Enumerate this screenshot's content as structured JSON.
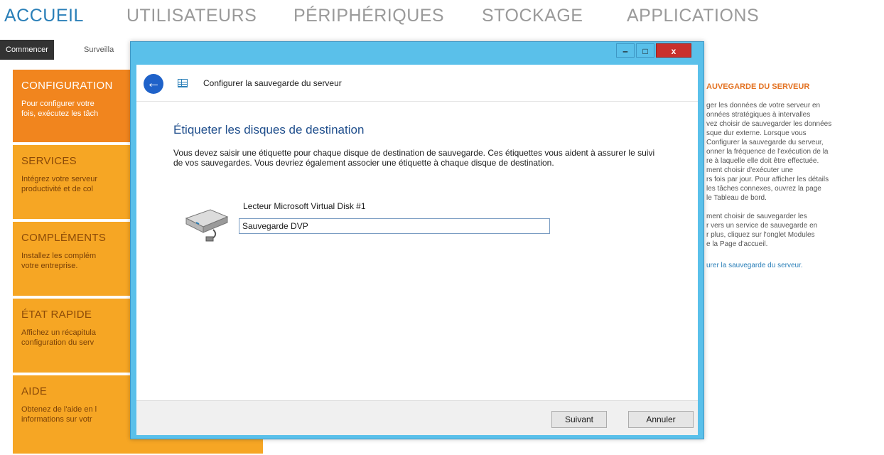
{
  "topnav": {
    "items": [
      {
        "label": "ACCUEIL"
      },
      {
        "label": "UTILISATEURS"
      },
      {
        "label": "PÉRIPHÉRIQUES"
      },
      {
        "label": "STOCKAGE"
      },
      {
        "label": "APPLICATIONS"
      }
    ]
  },
  "subtabs": [
    {
      "label": "Commencer"
    },
    {
      "label": "Surveilla"
    }
  ],
  "tiles": [
    {
      "title": "CONFIGURATION",
      "desc": "Pour configurer votre\nfois, exécutez les tâch"
    },
    {
      "title": "SERVICES",
      "desc": "Intégrez votre serveur\nproductivité et de col"
    },
    {
      "title": "COMPLÉMENTS",
      "desc": "Installez les complém\nvotre entreprise."
    },
    {
      "title": "ÉTAT RAPIDE",
      "desc": "Affichez un récapitula\nconfiguration du serv"
    },
    {
      "title": "AIDE",
      "desc": "Obtenez de l'aide en l\ninformations sur votr"
    }
  ],
  "rightpanel": {
    "title": "AUVEGARDE DU SERVEUR",
    "para1": "ger les données de votre serveur en\nonnées stratégiques à intervalles\nvez choisir de sauvegarder les données\nsque dur externe. Lorsque vous\n Configurer la sauvegarde du serveur,\nonner la fréquence de l'exécution de la\nre à laquelle elle doit être effectuée.\nment choisir d'exécuter une\nrs fois par jour. Pour afficher les détails\n les tâches connexes, ouvrez la page\nle Tableau de bord.",
    "para2": "ment choisir de sauvegarder les\nr vers un service de sauvegarde en\nr plus, cliquez sur l'onglet Modules\ne la Page d'accueil.",
    "link": "urer la sauvegarde du serveur."
  },
  "dialog": {
    "window": {
      "min": "‒",
      "max": "□",
      "close": "x"
    },
    "header_title": "Configurer la sauvegarde du serveur",
    "step_title": "Étiqueter les disques de destination",
    "description": "Vous devez saisir une étiquette pour chaque disque de destination de sauvegarde. Ces étiquettes vous aident à assurer le suivi de vos sauvegardes. Vous devriez également associer une étiquette à chaque disque de destination.",
    "disk_label": "Lecteur Microsoft Virtual Disk #1",
    "disk_value": "Sauvegarde DVP",
    "next_label": "Suivant",
    "cancel_label": "Annuler"
  },
  "colors": {
    "accent": "#2a7fb8",
    "tile_orange": "#f1851e",
    "tile_amber": "#f6a624",
    "dialog_frame": "#5ac0ea",
    "close_button": "#c9302c"
  }
}
